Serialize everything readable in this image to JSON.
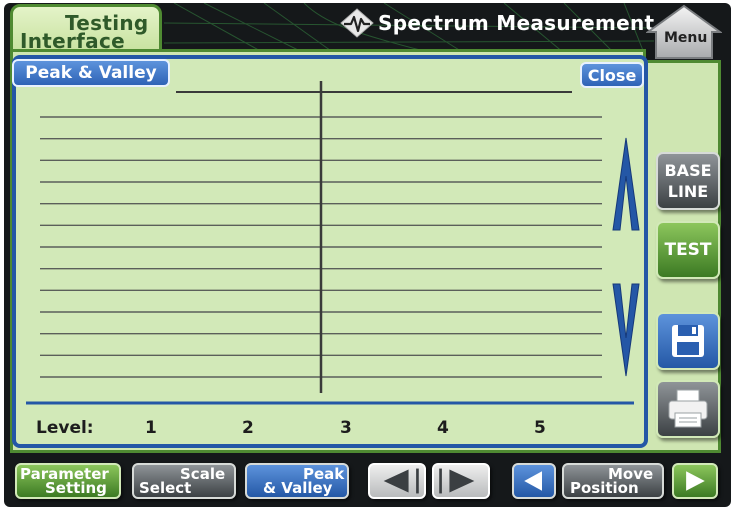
{
  "app": {
    "title_line1": "Testing",
    "title_line2": "Interface",
    "header_title": "Spectrum Measurement",
    "menu_label": "Menu"
  },
  "panel": {
    "tab_label": "Peak & Valley",
    "close_label": "Close",
    "level_label": "Level:",
    "levels": [
      "1",
      "2",
      "3",
      "4",
      "5"
    ],
    "grid_line_count": 13
  },
  "side_buttons": {
    "baseline_line1": "BASE",
    "baseline_line2": "LINE",
    "test_label": "TEST",
    "save_icon": "floppy-disk-icon",
    "print_icon": "printer-icon"
  },
  "toolbar": {
    "param_line1": "Parameter",
    "param_line2": "Setting",
    "scale_line1": "Scale",
    "scale_line2": "Select",
    "pv_line1": "Peak",
    "pv_line2": "& Valley",
    "move_line1": "Move",
    "move_line2": "Position"
  },
  "colors": {
    "accent_green": "#4f8a32",
    "panel_blue": "#2457a6",
    "panel_bg": "#d2e9b8"
  }
}
